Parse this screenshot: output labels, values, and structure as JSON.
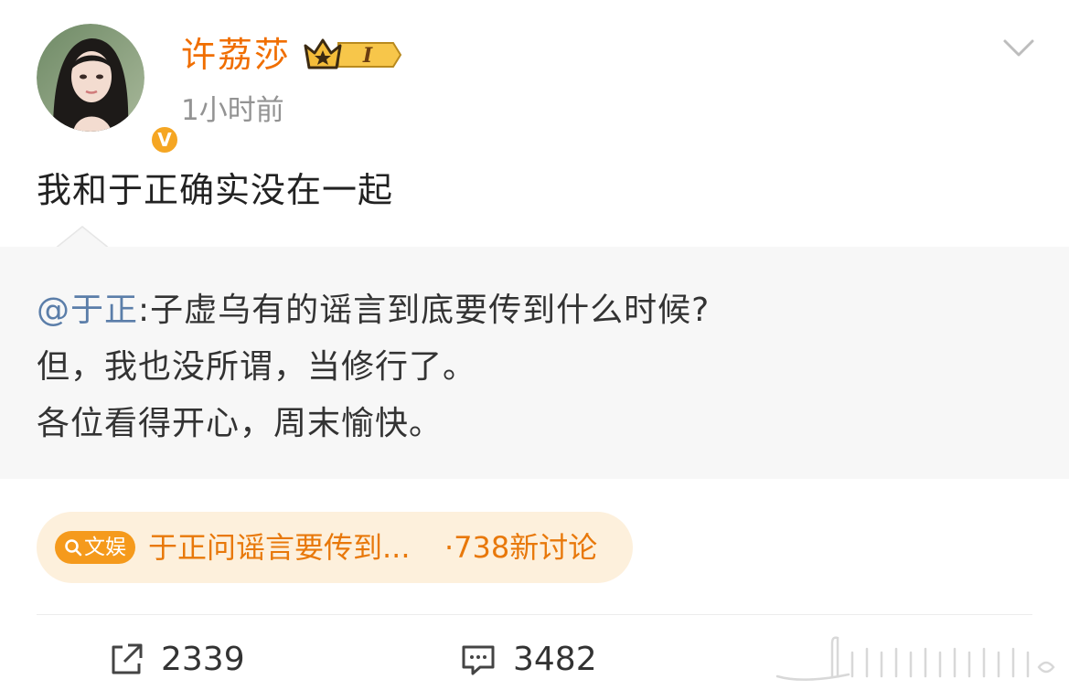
{
  "post": {
    "username": "许荔莎",
    "vip_level": "I",
    "verified_mark": "V",
    "timestamp": "1小时前",
    "text": "我和于正确实没在一起",
    "more_icon": "chevron-down-icon"
  },
  "repost": {
    "mention": "@于正",
    "line1_rest": ":子虚乌有的谣言到底要传到什么时候?",
    "line2": "但，我也没所谓，当修行了。",
    "line3": "各位看得开心，周末愉快。"
  },
  "topic": {
    "tag": "文娱",
    "title": "于正问谣言要传到...",
    "count_text": "·738新讨论"
  },
  "actions": {
    "share_count": "2339",
    "comment_count": "3482"
  },
  "colors": {
    "username": "#f06e00",
    "mention": "#5b7ea9",
    "topic_text": "#e8780a",
    "topic_bg": "#fdf0dc",
    "tag_bg": "#f59a1c",
    "repost_bg": "#f7f7f7"
  }
}
